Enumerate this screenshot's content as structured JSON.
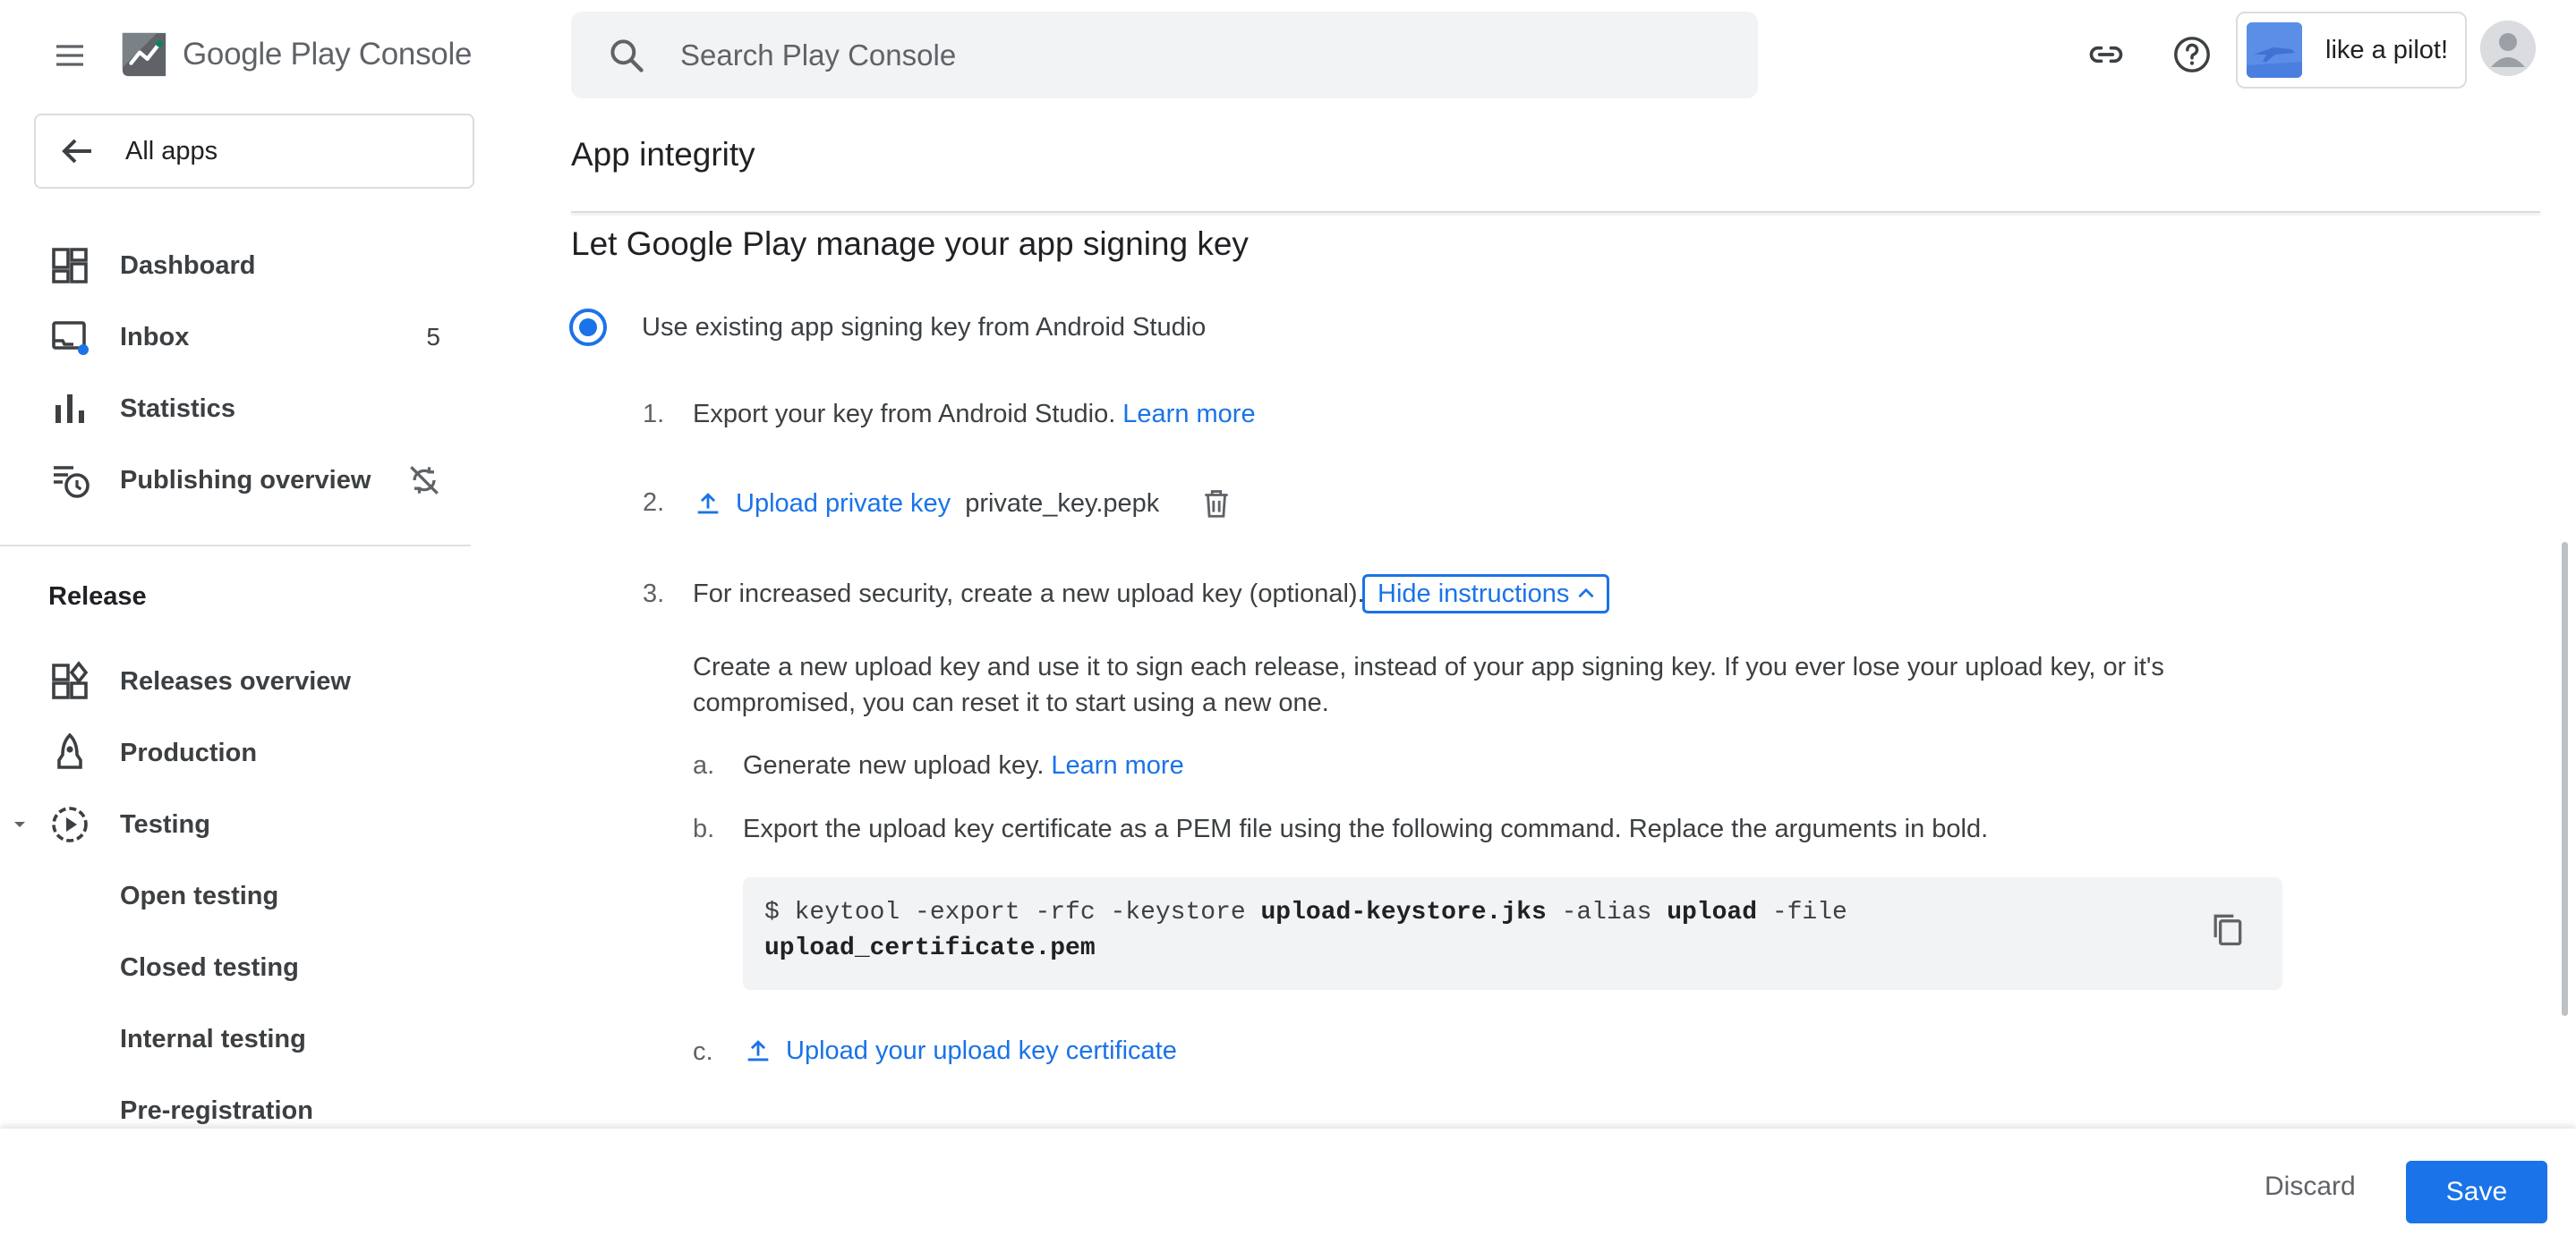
{
  "app": {
    "logo_text": "Google Play Console",
    "logo_accent_color": "#01875f"
  },
  "search": {
    "placeholder": "Search Play Console"
  },
  "header": {
    "developer_name": "like a pilot!"
  },
  "sidebar": {
    "all_apps_label": "All apps",
    "items": [
      {
        "label": "Dashboard",
        "icon": "dashboard-icon"
      },
      {
        "label": "Inbox",
        "icon": "inbox-icon",
        "count": "5"
      },
      {
        "label": "Statistics",
        "icon": "bar-chart-icon"
      },
      {
        "label": "Publishing overview",
        "icon": "publishing-icon",
        "trailing_icon": "sync-off-icon"
      }
    ],
    "release_section": {
      "title": "Release",
      "items": [
        {
          "label": "Releases overview",
          "icon": "releases-overview-icon"
        },
        {
          "label": "Production",
          "icon": "production-icon"
        },
        {
          "label": "Testing",
          "icon": "testing-icon",
          "expanded": true
        },
        {
          "label": "Open testing"
        },
        {
          "label": "Closed testing"
        },
        {
          "label": "Internal testing"
        },
        {
          "label": "Pre-registration"
        }
      ]
    }
  },
  "main": {
    "page_title": "App integrity",
    "section_heading": "Let Google Play manage your app signing key",
    "option_label": "Use existing app signing key from Android Studio",
    "steps": {
      "step1": {
        "num": "1.",
        "text": "Export your key from Android Studio.",
        "link": "Learn more"
      },
      "step2": {
        "num": "2.",
        "link": "Upload private key",
        "filename": "private_key.pepk"
      },
      "step3": {
        "num": "3.",
        "text": "For increased security, create a new upload key (optional).",
        "button": "Hide instructions"
      }
    },
    "instructions": {
      "paragraph": "Create a new upload key and use it to sign each release, instead of your app signing key. If you ever lose your upload key, or it's compromised, you can reset it to start using a new one.",
      "a": {
        "label": "a.",
        "text": "Generate new upload key.",
        "link": "Learn more"
      },
      "b": {
        "label": "b.",
        "text": "Export the upload key certificate as a PEM file using the following command. Replace the arguments in bold."
      },
      "command": {
        "prefix": "$ keytool -export -rfc -keystore ",
        "keystore": "upload-keystore.jks",
        "mid": " -alias ",
        "alias": "upload",
        "suffix": " -file",
        "file": "upload_certificate.pem"
      },
      "c": {
        "label": "c.",
        "link": "Upload your upload key certificate"
      }
    }
  },
  "footer": {
    "discard_label": "Discard",
    "save_label": "Save"
  },
  "colors": {
    "accent": "#1a73e8",
    "text": "#3c4043"
  }
}
